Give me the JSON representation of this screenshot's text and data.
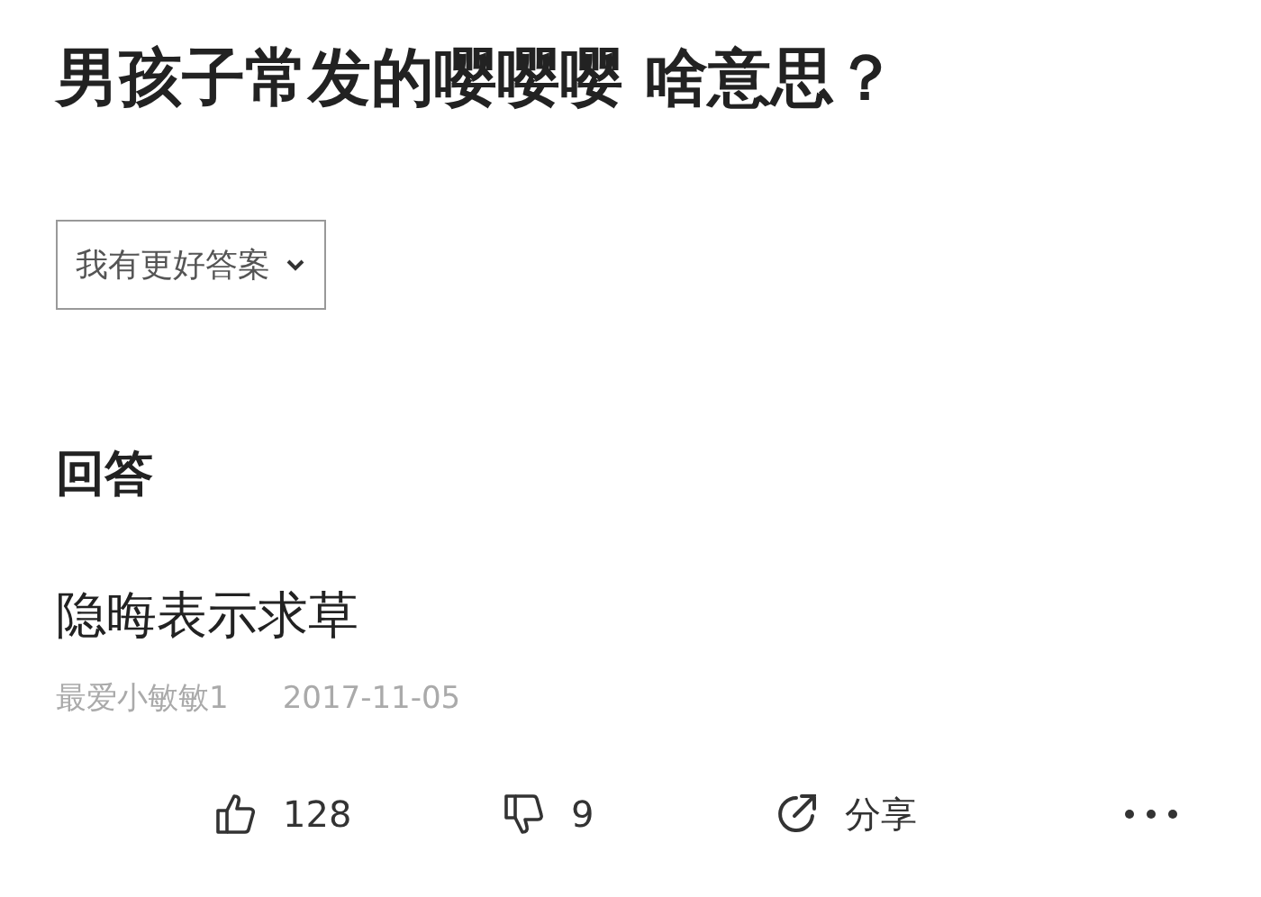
{
  "question": {
    "title": "男孩子常发的嘤嘤嘤 啥意思？"
  },
  "answer_button": {
    "label": "我有更好答案"
  },
  "section": {
    "heading": "回答"
  },
  "answer": {
    "text": "隐晦表示求草",
    "author": "最爱小敏敏1",
    "date": "2017-11-05"
  },
  "actions": [
    {
      "kind": "like",
      "label": "128"
    },
    {
      "kind": "dislike",
      "label": "9"
    },
    {
      "kind": "share",
      "label": "分享"
    },
    {
      "kind": "more"
    }
  ]
}
